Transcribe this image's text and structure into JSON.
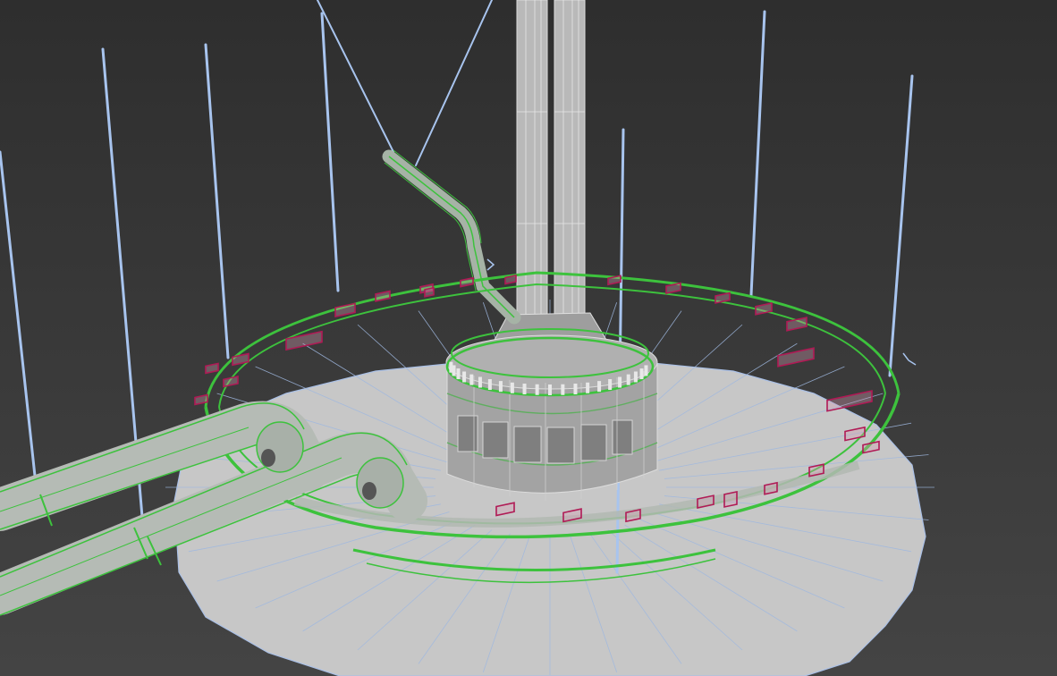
{
  "viewport": {
    "shading": "wireframe-over-shaded",
    "colors": {
      "background_top": "#2e2e2e",
      "background_bottom": "#444444",
      "platform_fill": "#c9c9c9",
      "platform_edge": "#9fb8e0",
      "mesh_gray": "#b8b8b8",
      "selection_green": "#34c134",
      "cable_blue": "#a8c4ee",
      "bracket_magenta": "#b01a55",
      "pipe_fill": "#a9b2a9"
    },
    "objects": [
      {
        "name": "base-platform",
        "kind": "disc"
      },
      {
        "name": "central-tower",
        "kind": "cylinder"
      },
      {
        "name": "twin-chimneys",
        "kind": "cylinder-pair"
      },
      {
        "name": "pipe-ring",
        "kind": "torus"
      },
      {
        "name": "intake-pipes",
        "kind": "pipe-pair"
      },
      {
        "name": "bent-feed-pipe",
        "kind": "pipe"
      },
      {
        "name": "support-cables",
        "kind": "lines"
      },
      {
        "name": "ring-brackets",
        "kind": "blocks"
      }
    ]
  }
}
